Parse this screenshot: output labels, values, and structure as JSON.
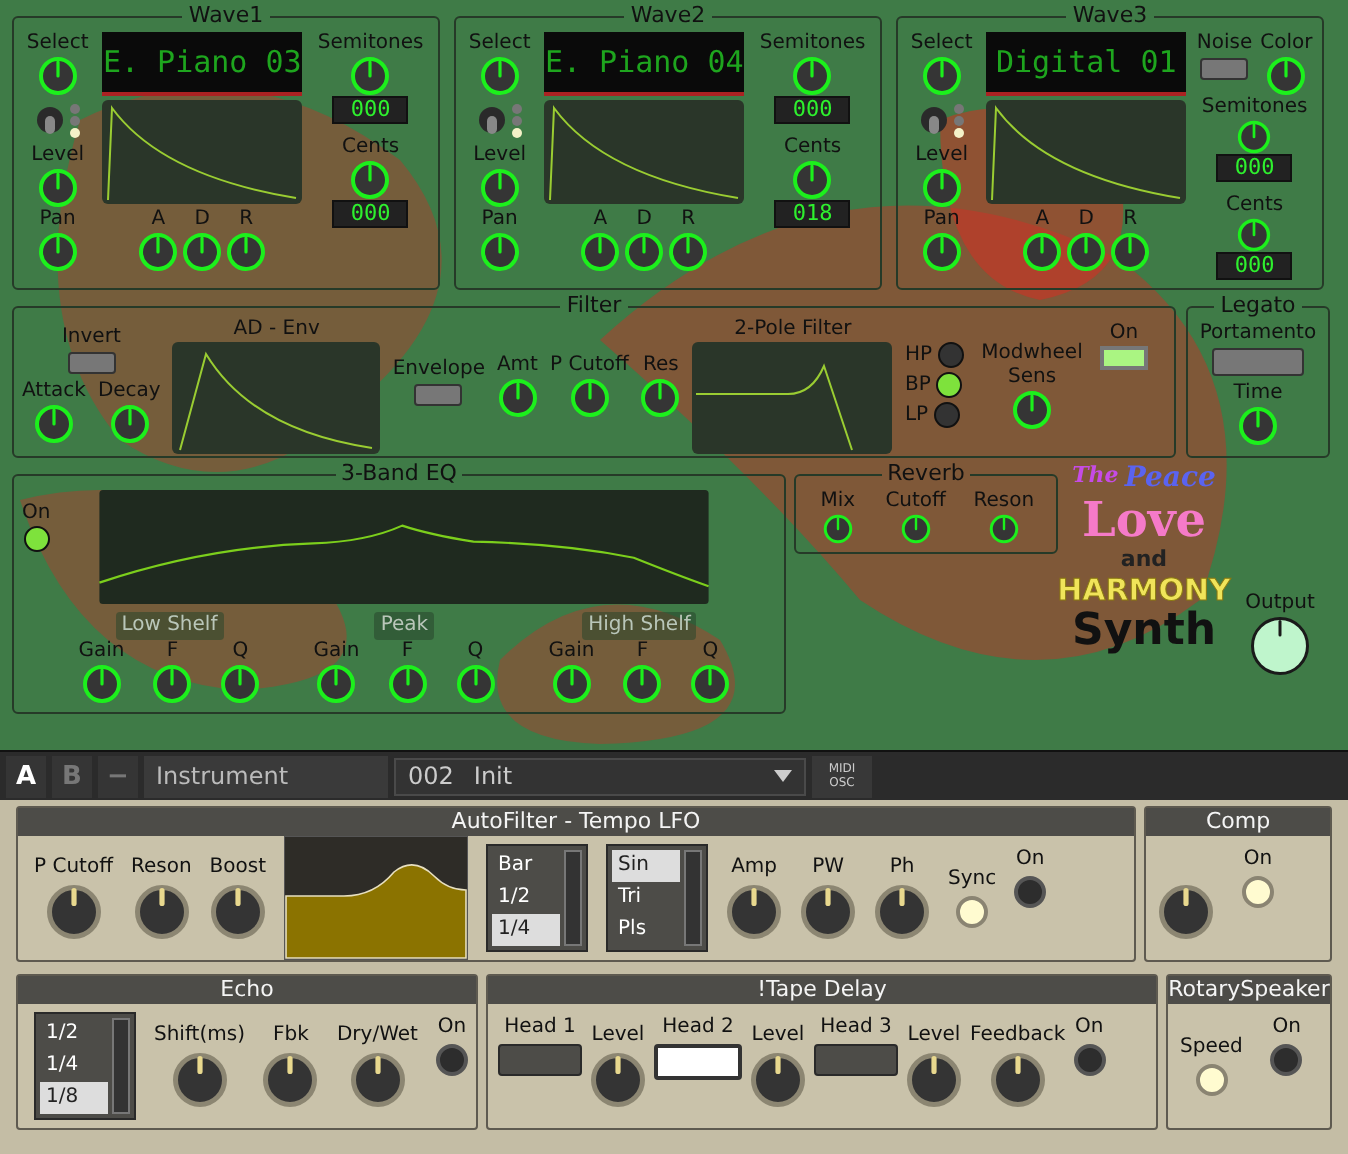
{
  "waves": [
    {
      "title": "Wave1",
      "display": "E. Piano 03",
      "select": {
        "label": "Select"
      },
      "leds": [
        {
          "on": false
        },
        {
          "on": false
        },
        {
          "on": true
        }
      ],
      "level": {
        "label": "Level"
      },
      "pan": {
        "label": "Pan"
      },
      "adsr": [
        {
          "label": "A"
        },
        {
          "label": "D"
        },
        {
          "label": "R"
        }
      ],
      "semitones": {
        "label": "Semitones",
        "reading": "000"
      },
      "cents": {
        "label": "Cents",
        "reading": "000"
      }
    },
    {
      "title": "Wave2",
      "display": "E. Piano 04",
      "select": {
        "label": "Select"
      },
      "leds": [
        {
          "on": false
        },
        {
          "on": false
        },
        {
          "on": true
        }
      ],
      "level": {
        "label": "Level"
      },
      "pan": {
        "label": "Pan"
      },
      "adsr": [
        {
          "label": "A"
        },
        {
          "label": "D"
        },
        {
          "label": "R"
        }
      ],
      "semitones": {
        "label": "Semitones",
        "reading": "000"
      },
      "cents": {
        "label": "Cents",
        "reading": "018"
      }
    },
    {
      "title": "Wave3",
      "display": "Digital 01",
      "select": {
        "label": "Select"
      },
      "leds": [
        {
          "on": false
        },
        {
          "on": false
        },
        {
          "on": true
        }
      ],
      "level": {
        "label": "Level"
      },
      "pan": {
        "label": "Pan"
      },
      "adsr": [
        {
          "label": "A"
        },
        {
          "label": "D"
        },
        {
          "label": "R"
        }
      ],
      "noise": {
        "label": "Noise",
        "on": false
      },
      "color": {
        "label": "Color"
      },
      "semitones": {
        "label": "Semitones",
        "reading": "000"
      },
      "cents": {
        "label": "Cents",
        "reading": "000"
      }
    }
  ],
  "filter": {
    "title": "Filter",
    "invert": {
      "label": "Invert",
      "on": false
    },
    "attack": {
      "label": "Attack"
    },
    "decay": {
      "label": "Decay"
    },
    "env_title": "AD - Env",
    "envelope": {
      "label": "Envelope",
      "on": false
    },
    "amt": {
      "label": "Amt"
    },
    "cutoff": {
      "label": "P Cutoff"
    },
    "res": {
      "label": "Res"
    },
    "filter_title": "2-Pole Filter",
    "modes": [
      {
        "label": "HP",
        "selected": false
      },
      {
        "label": "BP",
        "selected": true
      },
      {
        "label": "LP",
        "selected": false
      }
    ],
    "modwheel": {
      "label": "Modwheel Sens"
    },
    "on": {
      "label": "On",
      "on": true
    }
  },
  "legato": {
    "title": "Legato",
    "portamento": {
      "label": "Portamento",
      "on": false
    },
    "time": {
      "label": "Time"
    }
  },
  "eq": {
    "title": "3-Band EQ",
    "on": {
      "label": "On",
      "on": true
    },
    "bands": [
      {
        "name": "Low Shelf",
        "knobs": [
          {
            "label": "Gain"
          },
          {
            "label": "F"
          },
          {
            "label": "Q"
          }
        ]
      },
      {
        "name": "Peak",
        "knobs": [
          {
            "label": "Gain"
          },
          {
            "label": "F"
          },
          {
            "label": "Q"
          }
        ]
      },
      {
        "name": "High Shelf",
        "knobs": [
          {
            "label": "Gain"
          },
          {
            "label": "F"
          },
          {
            "label": "Q"
          }
        ]
      }
    ]
  },
  "reverb": {
    "title": "Reverb",
    "knobs": [
      {
        "label": "Mix"
      },
      {
        "label": "Cutoff"
      },
      {
        "label": "Reson"
      }
    ]
  },
  "logo": [
    "The",
    "Peace",
    "Love",
    "and",
    "HARMONY",
    "Synth"
  ],
  "output": {
    "label": "Output"
  },
  "toolbar": {
    "tabs": [
      {
        "label": "A",
        "selected": true
      },
      {
        "label": "B",
        "selected": false
      },
      {
        "label": "−",
        "selected": false
      }
    ],
    "name": "Instrument",
    "preset_number": "002",
    "preset_name": "Init",
    "midi": [
      "MIDI",
      "OSC"
    ]
  },
  "autofilter": {
    "title": "AutoFilter - Tempo LFO",
    "knobs": [
      {
        "label": "P Cutoff"
      },
      {
        "label": "Reson"
      },
      {
        "label": "Boost"
      }
    ],
    "rates": [
      {
        "label": "Bar",
        "selected": false
      },
      {
        "label": "1/2",
        "selected": false
      },
      {
        "label": "1/4",
        "selected": true
      }
    ],
    "shapes": [
      {
        "label": "Sin",
        "selected": true
      },
      {
        "label": "Tri",
        "selected": false
      },
      {
        "label": "Pls",
        "selected": false
      }
    ],
    "knobs2": [
      {
        "label": "Amp"
      },
      {
        "label": "PW"
      },
      {
        "label": "Ph"
      }
    ],
    "sync": {
      "label": "Sync",
      "on": true
    },
    "on": {
      "label": "On",
      "on": false
    }
  },
  "comp": {
    "title": "Comp",
    "on": {
      "label": "On",
      "on": true
    }
  },
  "echo": {
    "title": "Echo",
    "rates": [
      {
        "label": "1/2",
        "selected": false
      },
      {
        "label": "1/4",
        "selected": false
      },
      {
        "label": "1/8",
        "selected": true
      }
    ],
    "knobs": [
      {
        "label": "Shift(ms)"
      },
      {
        "label": "Fbk"
      },
      {
        "label": "Dry/Wet"
      }
    ],
    "on": {
      "label": "On",
      "on": false
    }
  },
  "tape_delay": {
    "title": "!Tape Delay",
    "heads": [
      {
        "label": "Head 1",
        "on": false,
        "level_label": "Level"
      },
      {
        "label": "Head 2",
        "on": true,
        "level_label": "Level"
      },
      {
        "label": "Head 3",
        "on": false,
        "level_label": "Level"
      }
    ],
    "feedback": {
      "label": "Feedback"
    },
    "on": {
      "label": "On",
      "on": false
    }
  },
  "rotary": {
    "title": "RotarySpeaker",
    "speed": {
      "label": "Speed",
      "on": true
    },
    "on": {
      "label": "On",
      "on": false
    }
  }
}
